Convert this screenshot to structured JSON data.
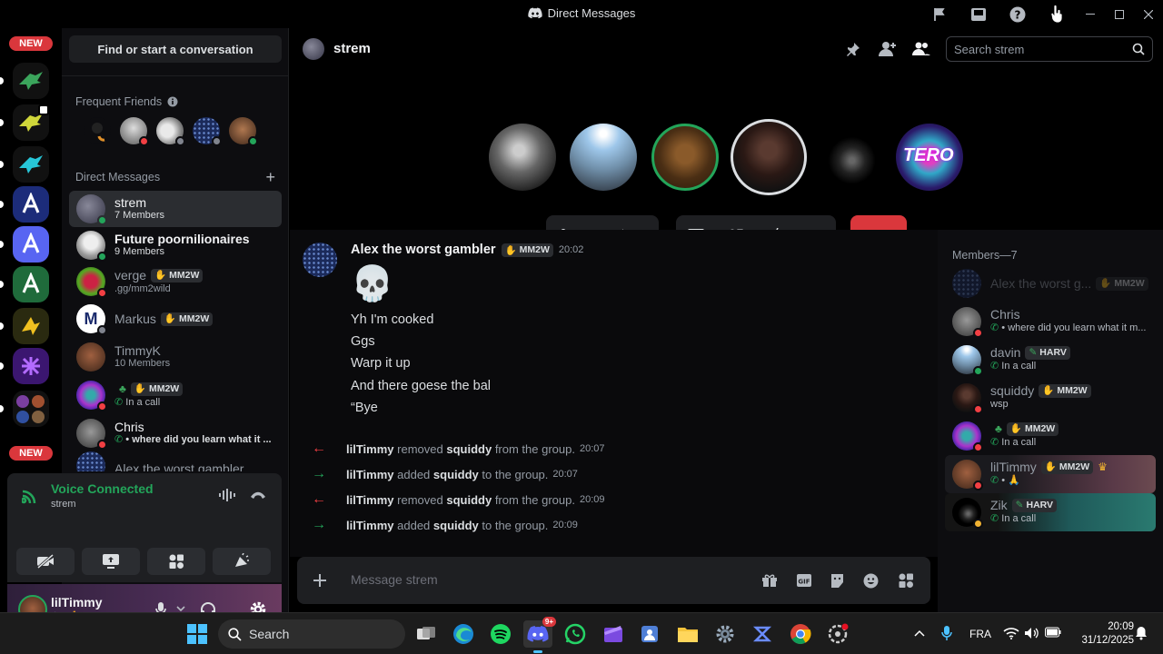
{
  "window": {
    "title": "Direct Messages"
  },
  "guilds": {
    "new_badge_top": "NEW",
    "new_badge_bottom": "NEW"
  },
  "sidebar": {
    "find_label": "Find or start a conversation",
    "frequent_friends_label": "Frequent Friends",
    "dm_section_label": "Direct Messages",
    "dms": [
      {
        "name": "strem",
        "sub": "7 Members",
        "selected": true
      },
      {
        "name": "Future poornilionaires",
        "sub": "9 Members"
      },
      {
        "name": "verge",
        "tag": "MM2W",
        "sub": ".gg/mm2wild"
      },
      {
        "name": "Markus",
        "tag": "MM2W",
        "sub": ""
      },
      {
        "name": "TimmyK",
        "sub": "10 Members"
      },
      {
        "name": "",
        "tag": "MM2W",
        "sub": "In a call"
      },
      {
        "name": "Chris",
        "sub": "• where did you learn what it ..."
      },
      {
        "name": "Alex the worst gambler",
        "sub": ""
      }
    ],
    "voice": {
      "title": "Voice Connected",
      "channel": "strem"
    },
    "user": {
      "name": "lilTimmy"
    }
  },
  "header": {
    "channel": "strem",
    "search_placeholder": "Search strem"
  },
  "chat": {
    "author": "Alex the worst gambler",
    "author_tag": "MM2W",
    "time": "20:02",
    "emoji": "💀",
    "lines": [
      "Yh I'm cooked",
      "Ggs",
      "Warp it up",
      "And there goese the bal",
      "“Bye"
    ],
    "system": [
      {
        "actor": "lilTimmy",
        "action": "removed",
        "target": "squiddy",
        "rest": "from the group.",
        "time": "20:07",
        "type": "remove"
      },
      {
        "actor": "lilTimmy",
        "action": "added",
        "target": "squiddy",
        "rest": "to the group.",
        "time": "20:07",
        "type": "add"
      },
      {
        "actor": "lilTimmy",
        "action": "removed",
        "target": "squiddy",
        "rest": "from the group.",
        "time": "20:09",
        "type": "remove"
      },
      {
        "actor": "lilTimmy",
        "action": "added",
        "target": "squiddy",
        "rest": "to the group.",
        "time": "20:09",
        "type": "add"
      }
    ],
    "composer_placeholder": "Message strem"
  },
  "members": {
    "header": "Members—7",
    "list": [
      {
        "name": "Alex the worst g...",
        "tag": "MM2W",
        "sub": ""
      },
      {
        "name": "Chris",
        "sub": "• where did you learn what it m..."
      },
      {
        "name": "davin",
        "tag": "HARV",
        "sub": "In a call"
      },
      {
        "name": "squiddy",
        "tag": "MM2W",
        "sub": "wsp"
      },
      {
        "name": "",
        "tag": "MM2W",
        "sub": "In a call"
      },
      {
        "name": "lilTimmy",
        "tag": "MM2W",
        "sub": "• 🙏"
      },
      {
        "name": "Zik",
        "tag": "HARV",
        "sub": "In a call"
      }
    ]
  },
  "taskbar": {
    "search_label": "Search",
    "lang": "FRA",
    "time": "20:09",
    "date": "31/12/2025",
    "discord_badge": "9+"
  },
  "colors": {
    "accent_green": "#23a55a",
    "danger_red": "#da373c",
    "blurple": "#5865f2"
  }
}
